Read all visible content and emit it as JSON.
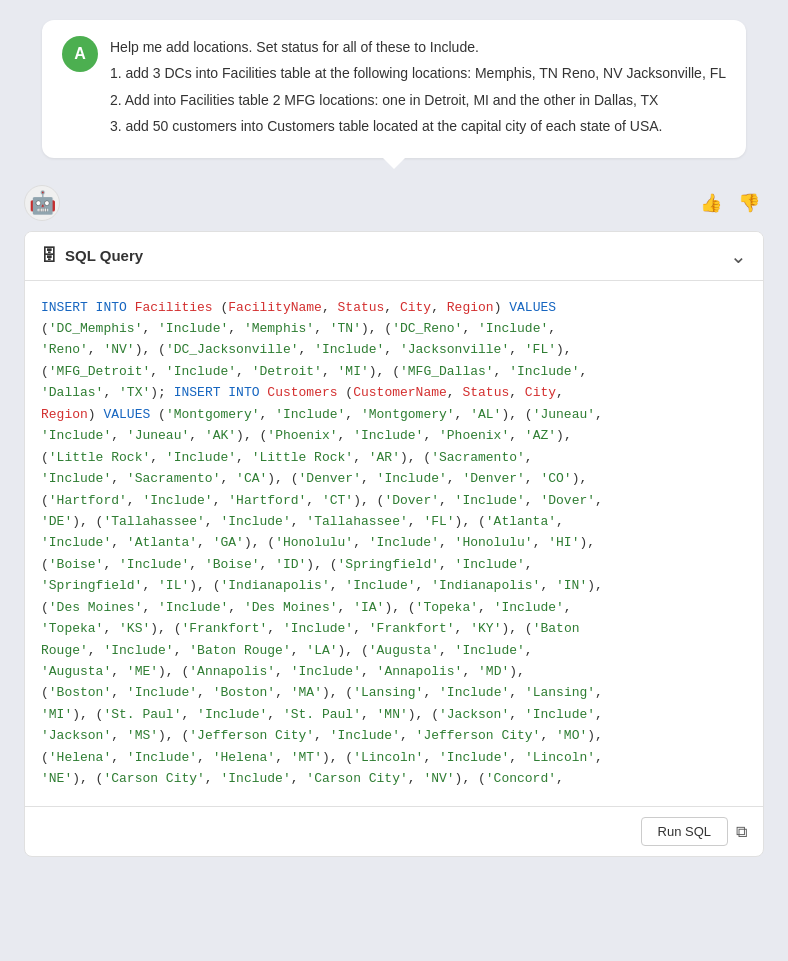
{
  "user": {
    "avatar_letter": "A",
    "message": {
      "intro": "Help me add locations. Set status for all of these to Include.",
      "point1": "1. add 3 DCs into Facilities table at the following locations: Memphis, TN Reno, NV Jacksonville, FL",
      "point2": "2. Add into Facilities table 2 MFG locations: one in Detroit, MI and the other in Dallas, TX",
      "point3": "3. add 50 customers into Customers table located at the capital city of each state of USA."
    }
  },
  "ai": {
    "avatar_emoji": "🤖",
    "thumbs_up": "👍",
    "thumbs_down": "👎",
    "sql_query": {
      "title": "SQL Query",
      "db_icon": "🗄",
      "chevron": "∨",
      "code": "INSERT INTO Facilities (FacilityName, Status, City, Region) VALUES\n('DC_Memphis', 'Include', 'Memphis', 'TN'), ('DC_Reno', 'Include',\n'Reno', 'NV'), ('DC_Jacksonville', 'Include', 'Jacksonville', 'FL'),\n('MFG_Detroit', 'Include', 'Detroit', 'MI'), ('MFG_Dallas', 'Include',\n'Dallas', 'TX'); INSERT INTO Customers (CustomerName, Status, City,\nRegion) VALUES ('Montgomery', 'Include', 'Montgomery', 'AL'), ('Juneau',\n'Include', 'Juneau', 'AK'), ('Phoenix', 'Include', 'Phoenix', 'AZ'),\n('Little Rock', 'Include', 'Little Rock', 'AR'), ('Sacramento',\n'Include', 'Sacramento', 'CA'), ('Denver', 'Include', 'Denver', 'CO'),\n('Hartford', 'Include', 'Hartford', 'CT'), ('Dover', 'Include', 'Dover',\n'DE'), ('Tallahassee', 'Include', 'Tallahassee', 'FL'), ('Atlanta',\n'Include', 'Atlanta', 'GA'), ('Honolulu', 'Include', 'Honolulu', 'HI'),\n('Boise', 'Include', 'Boise', 'ID'), ('Springfield', 'Include',\n'Springfield', 'IL'), ('Indianapolis', 'Include', 'Indianapolis', 'IN'),\n('Des Moines', 'Include', 'Des Moines', 'IA'), ('Topeka', 'Include',\n'Topeka', 'KS'), ('Frankfort', 'Include', 'Frankfort', 'KY'), ('Baton\nRouge', 'Include', 'Baton Rouge', 'LA'), ('Augusta', 'Include',\n'Augusta', 'ME'), ('Annapolis', 'Include', 'Annapolis', 'MD'),\n('Boston', 'Include', 'Boston', 'MA'), ('Lansing', 'Include', 'Lansing',\n'MI'), ('St. Paul', 'Include', 'St. Paul', 'MN'), ('Jackson', 'Include',\n'Jackson', 'MS'), ('Jefferson City', 'Include', 'Jefferson City', 'MO'),\n('Helena', 'Include', 'Helena', 'MT'), ('Lincoln', 'Include', 'Lincoln',\n'NE'), ('Carson City', 'Include', 'Carson City', 'NV'), ('Concord',",
      "run_label": "Run SQL",
      "copy_icon": "⧉"
    }
  }
}
